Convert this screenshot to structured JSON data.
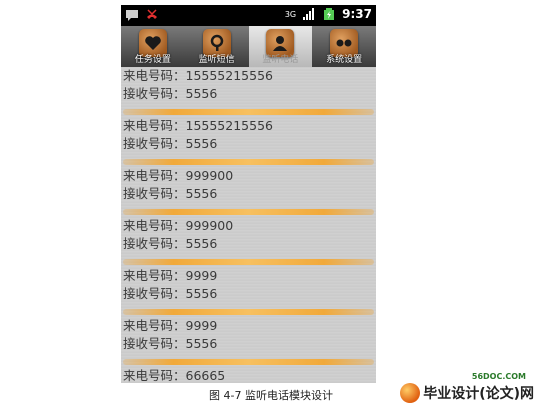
{
  "status_bar": {
    "icons": [
      "message-icon",
      "missed-call-icon",
      "3g-icon",
      "signal-icon",
      "battery-icon"
    ],
    "network": "3G",
    "time": "9:37"
  },
  "tabs": [
    {
      "label": "任务设置",
      "icon": "heart-icon",
      "active": false
    },
    {
      "label": "监听短信",
      "icon": "magnifier-icon",
      "active": false
    },
    {
      "label": "监听电话",
      "icon": "person-icon",
      "active": true
    },
    {
      "label": "系统设置",
      "icon": "dots-icon",
      "active": false
    }
  ],
  "records": [
    {
      "caller": "来电号码：15555215556",
      "receiver": "接收号码：5556"
    },
    {
      "caller": "来电号码：15555215556",
      "receiver": "接收号码：5556"
    },
    {
      "caller": "来电号码：999900",
      "receiver": "接收号码：5556"
    },
    {
      "caller": "来电号码：999900",
      "receiver": "接收号码：5556"
    },
    {
      "caller": "来电号码：9999",
      "receiver": "接收号码：5556"
    },
    {
      "caller": "来电号码：9999",
      "receiver": "接收号码：5556"
    },
    {
      "caller": "来电号码：66665",
      "receiver": ""
    }
  ],
  "caption": "图 4-7 监听电话模块设计",
  "watermark": {
    "url": "56DOC.COM",
    "text": "毕业设计(论文)网"
  },
  "colors": {
    "divider": "#f1a93a",
    "tab_icon": "#b8692a",
    "statusbar": "#000000"
  }
}
